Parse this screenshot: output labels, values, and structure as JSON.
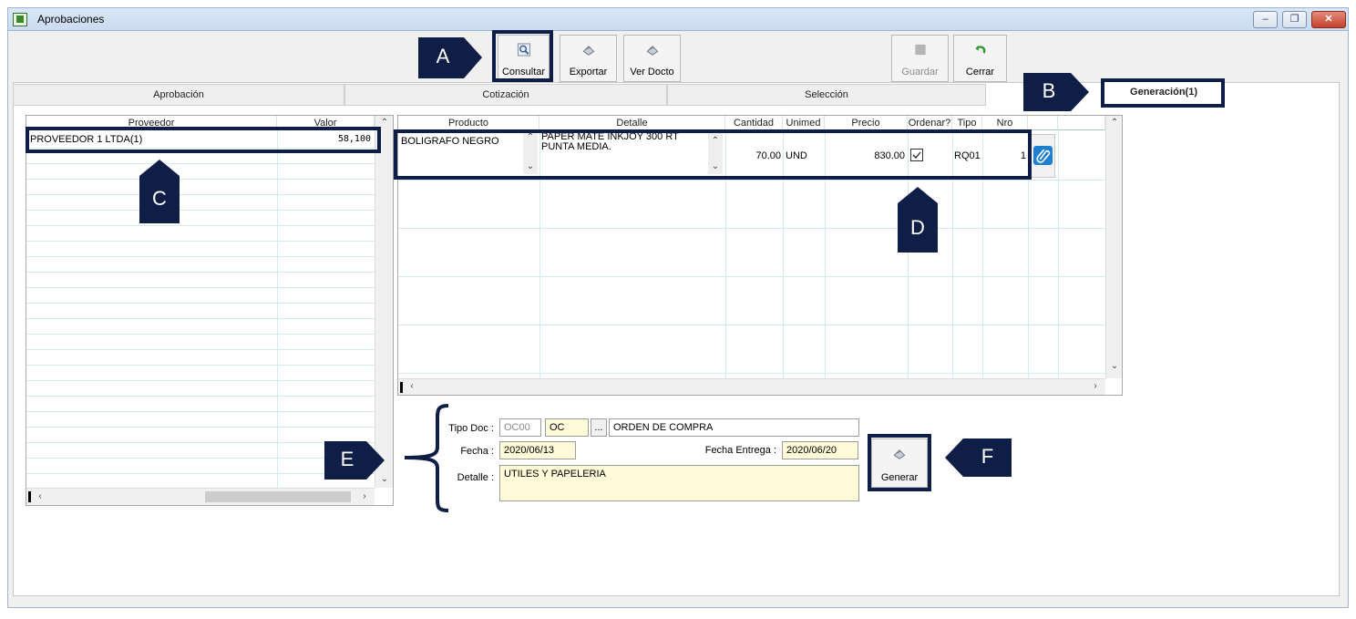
{
  "window": {
    "title": "Aprobaciones",
    "controls": {
      "minimize": "‒",
      "restore": "❐",
      "close": "✕"
    }
  },
  "toolbar": {
    "consultar": "Consultar",
    "exportar": "Exportar",
    "ver_docto": "Ver Docto",
    "guardar": "Guardar",
    "cerrar": "Cerrar"
  },
  "tabs": [
    "Aprobación",
    "Cotización",
    "Selección",
    "Generación(1)"
  ],
  "markers": {
    "a": "A",
    "b": "B",
    "c": "C",
    "d": "D",
    "e": "E",
    "f": "F"
  },
  "providers": {
    "columns": [
      "Proveedor",
      "Valor"
    ],
    "rows": [
      {
        "proveedor": "PROVEEDOR 1 LTDA(1)",
        "valor": "58,100"
      }
    ]
  },
  "products": {
    "columns": [
      "Producto",
      "Detalle",
      "Cantidad",
      "Unimed",
      "Precio",
      "Ordenar?",
      "Tipo",
      "Nro"
    ],
    "rows": [
      {
        "producto": "BOLIGRAFO NEGRO",
        "detalle": "PAPER MATE INKJOY 300 RT PUNTA MEDIA.",
        "cantidad": "70.00",
        "unimed": "UND",
        "precio": "830.00",
        "ordenar": true,
        "tipo": "RQ01",
        "nro": "1"
      }
    ]
  },
  "form": {
    "tipo_doc_label": "Tipo Doc :",
    "tipo_doc_code": "OC00",
    "tipo_doc_short": "OC",
    "ellipsis": "...",
    "tipo_doc_desc": "ORDEN DE COMPRA",
    "fecha_label": "Fecha :",
    "fecha": "2020/06/13",
    "fecha_entrega_label": "Fecha Entrega :",
    "fecha_entrega": "2020/06/20",
    "detalle_label": "Detalle :",
    "detalle": "UTILES Y PAPELERIA",
    "generar": "Generar"
  },
  "colors": {
    "marker": "#0f1e46",
    "field_yellow": "#fffbd9",
    "grid_line": "#d2ecec",
    "attach_blue": "#1e7fd0"
  }
}
